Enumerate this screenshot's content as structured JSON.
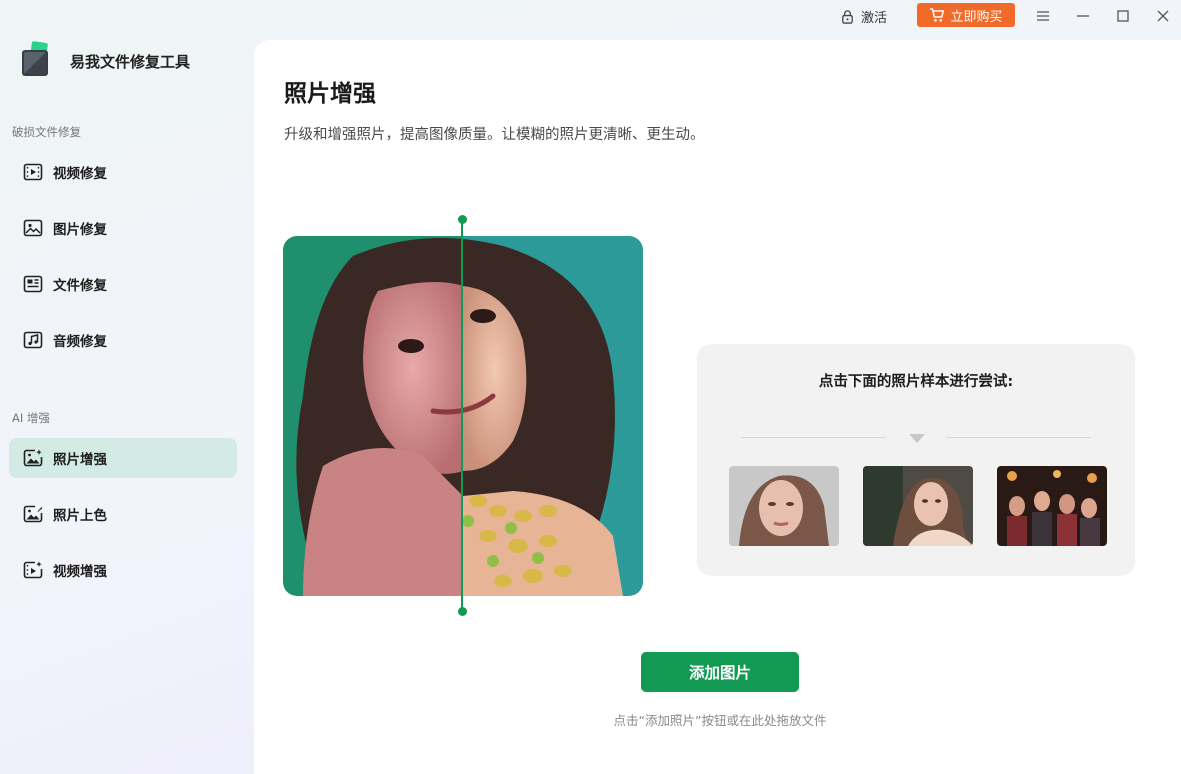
{
  "app": {
    "title": "易我文件修复工具"
  },
  "titlebar": {
    "activate_label": "激活",
    "buy_label": "立即购买"
  },
  "sidebar": {
    "sections": [
      {
        "label": "破损文件修复"
      },
      {
        "label": "AI 增强"
      }
    ],
    "items": [
      {
        "label": "视频修复",
        "icon": "video-icon"
      },
      {
        "label": "图片修复",
        "icon": "image-icon"
      },
      {
        "label": "文件修复",
        "icon": "document-icon"
      },
      {
        "label": "音频修复",
        "icon": "music-icon"
      },
      {
        "label": "照片增强",
        "icon": "photo-enhance-icon",
        "active": true
      },
      {
        "label": "照片上色",
        "icon": "photo-colorize-icon"
      },
      {
        "label": "视频增强",
        "icon": "video-enhance-icon"
      }
    ]
  },
  "main": {
    "title": "照片增强",
    "subtitle": "升级和增强照片，提高图像质量。让模糊的照片更清晰、更生动。",
    "samples": {
      "title": "点击下面的照片样本进行尝试:"
    },
    "add_button": "添加图片",
    "hint": "点击“添加照片”按钮或在此处拖放文件"
  },
  "colors": {
    "accent": "#129a52",
    "buy": "#f26a2a",
    "active_nav": "#d3ebe4"
  }
}
